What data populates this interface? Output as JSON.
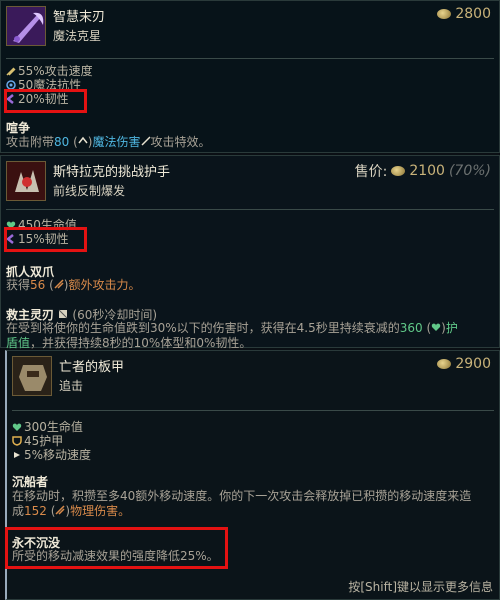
{
  "item1": {
    "name": "智慧末刃",
    "category": "魔法克星",
    "price": "2800",
    "stats": [
      "55%攻击速度",
      "50魔法抗性",
      "20%韧性"
    ],
    "passive_title": "喧争",
    "passive_desc": {
      "prefix": "攻击附带",
      "value": "80",
      "middle": " (",
      "dmg": "魔法伤害",
      "suffix": "攻击特效。"
    }
  },
  "item2": {
    "name": "斯特拉克的挑战护手",
    "category": "前线反制爆发",
    "price_label": "售价:",
    "price": "2100",
    "price_pct": "(70%)",
    "stats": [
      "450生命值",
      "15%韧性"
    ],
    "passive1_title": "抓人双爪",
    "passive1_desc": {
      "prefix": "获得",
      "value": "56",
      "middle": " (",
      "dmg": "额外攻击力。"
    },
    "passive2_title": "救主灵刃",
    "passive2_cd": "(60秒冷却时间)",
    "passive2_desc": {
      "line1_prefix": "在受到将使你的生命值跌到30%以下的伤害时，获得在4.5秒里持续衰减的",
      "value": "360",
      "line1_mid": " (",
      "heal": "护",
      "line2_heal": "盾值",
      "line2_rest": "，并获得持续8秒的10%体型和0%韧性。"
    }
  },
  "item3": {
    "name": "亡者的板甲",
    "category": "追击",
    "price": "2900",
    "stats": [
      "300生命值",
      "45护甲",
      "5%移动速度"
    ],
    "passive1_title": "沉船者",
    "passive1_desc": {
      "line1": "在移动时，积攒至多40额外移动速度。你的下一次攻击会释放掉已积攒的移动速度来造",
      "line2_prefix": "成",
      "value": "152",
      "middle": " (",
      "dmg": "物理伤害。"
    },
    "passive2_title": "永不沉没",
    "passive2_desc": "所受的移动减速效果的强度降低25%。"
  },
  "footer": "按[Shift]键以显示更多信息",
  "colors": {
    "highlight_box": "#e41212",
    "gold": "#c9a24a",
    "magic": "#4fb6e0",
    "physical": "#d88a4a",
    "heal": "#60c888"
  }
}
